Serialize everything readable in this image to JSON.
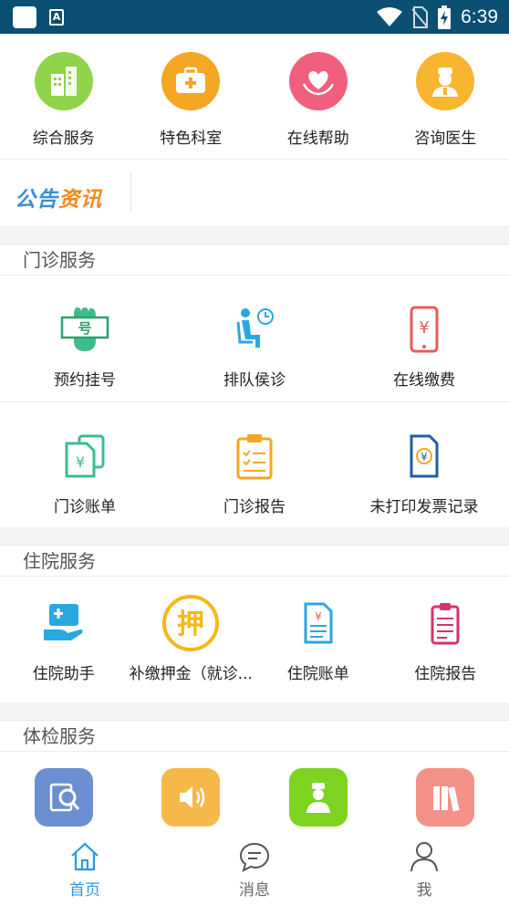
{
  "status_bar": {
    "time": "6:39"
  },
  "top_services": [
    {
      "label": "综合服务",
      "color": "#8fd44b"
    },
    {
      "label": "特色科室",
      "color": "#f5a623"
    },
    {
      "label": "在线帮助",
      "color": "#f0607e"
    },
    {
      "label": "咨询医生",
      "color": "#f7b530"
    }
  ],
  "notice": {
    "logo_part1": "公告",
    "logo_part2": "资讯"
  },
  "outpatient": {
    "title": "门诊服务",
    "row1": [
      {
        "label": "预约挂号"
      },
      {
        "label": "排队侯诊"
      },
      {
        "label": "在线缴费"
      }
    ],
    "row2": [
      {
        "label": "门诊账单"
      },
      {
        "label": "门诊报告"
      },
      {
        "label": "未打印发票记录"
      }
    ]
  },
  "inpatient": {
    "title": "住院服务",
    "items": [
      {
        "label": "住院助手"
      },
      {
        "label": "补缴押金（就诊..."
      },
      {
        "label": "住院账单"
      },
      {
        "label": "住院报告"
      }
    ],
    "deposit_glyph": "押"
  },
  "physical": {
    "title": "体检服务",
    "colors": [
      "#6b8fd1",
      "#f7b84a",
      "#7ed321",
      "#f4928a"
    ]
  },
  "tabs": [
    {
      "label": "首页",
      "active": true
    },
    {
      "label": "消息",
      "active": false
    },
    {
      "label": "我",
      "active": false
    }
  ],
  "colors": {
    "accent": "#2a98dc",
    "status_bar": "#0b4f73"
  }
}
